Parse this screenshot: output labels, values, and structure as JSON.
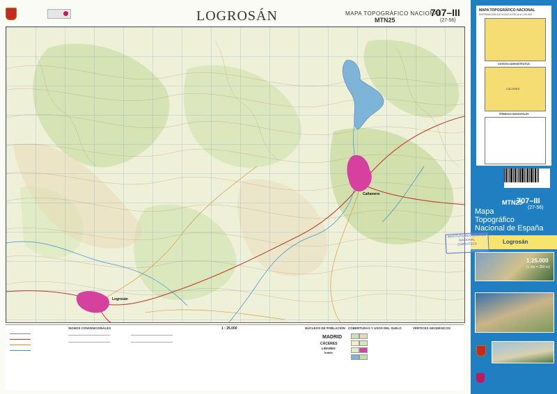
{
  "header": {
    "title": "LOGROSÁN",
    "series": "MAPA TOPOGRÁFICO NACIONAL",
    "mtn": "MTN25",
    "sheet_number": "707–III",
    "sheet_sub": "(27-56)"
  },
  "map": {
    "places": [
      {
        "text": "Logrosán",
        "style": "town"
      },
      {
        "text": "Cañamero",
        "style": "town"
      }
    ]
  },
  "legend": {
    "conventional_signs": "SIGNOS CONVENCIONALES",
    "scale": "1 : 25.000",
    "population": "NÚCLEOS DE POBLACIÓN",
    "land_cover": "COBERTURAS Y USOS DEL SUELO",
    "geodetic": "VÉRTICES GEODÉSICOS",
    "cities": [
      "MADRID",
      "CÁCERES",
      "LINARES",
      "Tudela"
    ]
  },
  "panel": {
    "index_title": "MAPA TOPOGRÁFICO NACIONAL",
    "index_sub": "DISTRIBUCIÓN DE HOJAS A ESCALA 1:50.000",
    "admin_division": "DIVISIÓN ADMINISTRATIVA",
    "municipal_terms": "TÉRMINOS MUNICIPALES",
    "province": "CÁCERES",
    "sheet_number": "707–III",
    "mtn": "MTN25",
    "sheet_sub": "(27-56)",
    "series_line1": "Mapa",
    "series_line2": "Topográfico",
    "series_line3": "Nacional de España",
    "name": "Logrosán",
    "scale": "1:25.000",
    "scale_sub": "(1 cm = 250 m)",
    "stamp_line1": "INSTITUTO GEOGRÁFICO",
    "stamp_line2": "NACIONAL",
    "stamp_line3": "CARTOTECA"
  },
  "colors": {
    "panel_blue": "#1f7fc1",
    "map_bg": "#f1f2de",
    "water": "#7fb4d9",
    "urban": "#d6409f",
    "panel_yellow": "#f8e36f"
  }
}
